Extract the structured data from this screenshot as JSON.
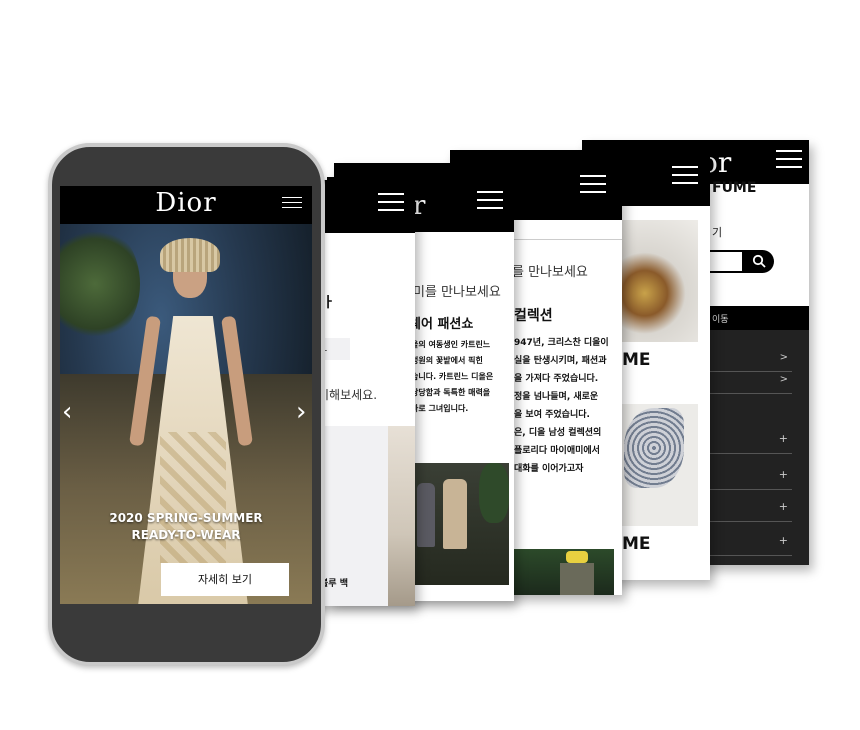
{
  "brand": {
    "logo": "Dior"
  },
  "phone": {
    "hero_title_line1": "2020 SPRING-SUMMER",
    "hero_title_line2": "READY-TO-WEAR",
    "cta_label": "자세히 보기",
    "prev_icon": "chevron-left-icon",
    "next_icon": "chevron-right-icon"
  },
  "cards": {
    "c1": {
      "frag_header": "ㅏ",
      "frag_gray": "ㄴ",
      "frag_text": "비해보세요.",
      "frag_caption": "블루 백"
    },
    "c2": {
      "logo_frag": "r",
      "subtitle": "미를 만나보세요",
      "heading": "웨어 패션쇼",
      "body": [
        "울의 여동생인 카트린느",
        "정원의 꽃밭에서 픽힌",
        "습니다. 카트린느 디올은",
        "당당함과 독특한 매력을",
        "바로 그녀입니다."
      ]
    },
    "c3": {
      "subtitle": "를 만나보세요",
      "heading": "컬렉션",
      "body": [
        "947년, 크리스찬 디올이",
        "실을 탄생시키며, 패션과",
        "을 가져다 주었습니다.",
        "정을 넘나들며, 새로운",
        "을 보여 주었습니다.",
        "은, 디올 남성 컬렉션의",
        "플로리다 마이애미에서",
        "대화를 이어가고자"
      ]
    },
    "c4": {
      "label1": "ME",
      "label2": "ME"
    },
    "c5": {
      "logo_frag": "ior",
      "title_frag": "FUME",
      "search_label": "기",
      "search_icon": "search-icon",
      "nav_label": "이동",
      "rows": [
        ">",
        ">",
        "+",
        "+",
        "+",
        "+"
      ]
    }
  }
}
